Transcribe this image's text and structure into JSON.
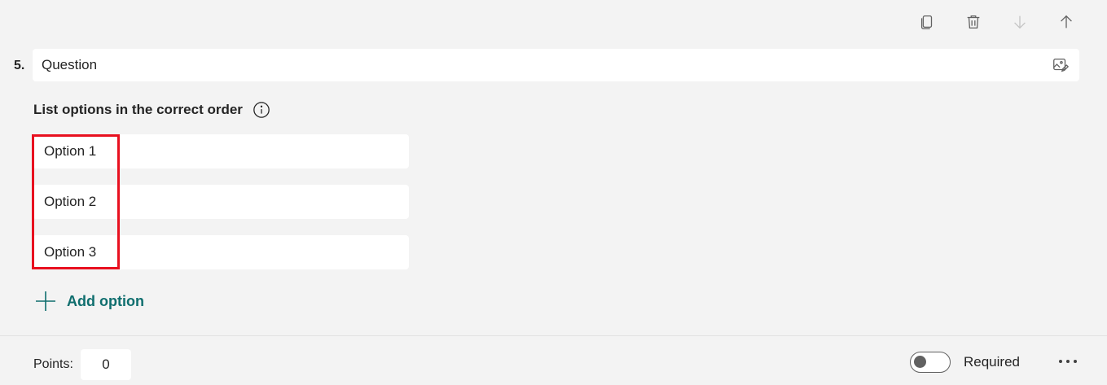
{
  "toolbar": {
    "copy_icon": "copy-icon",
    "delete_icon": "trash-icon",
    "move_down_icon": "arrow-down-icon",
    "move_up_icon": "arrow-up-icon"
  },
  "question": {
    "number": "5.",
    "title": "Question",
    "image_icon": "image-edit-icon"
  },
  "instruction": {
    "text": "List options in the correct order",
    "info_icon": "info-icon"
  },
  "options": [
    {
      "label": "Option 1"
    },
    {
      "label": "Option 2"
    },
    {
      "label": "Option 3"
    }
  ],
  "add_option": {
    "label": "Add option",
    "icon": "plus-icon"
  },
  "footer": {
    "points_label": "Points:",
    "points_value": "0",
    "required_label": "Required",
    "required_on": false,
    "more_icon": "more-icon"
  },
  "colors": {
    "accent": "#0f6e6e",
    "highlight": "#e8101f",
    "background": "#f3f3f3"
  }
}
